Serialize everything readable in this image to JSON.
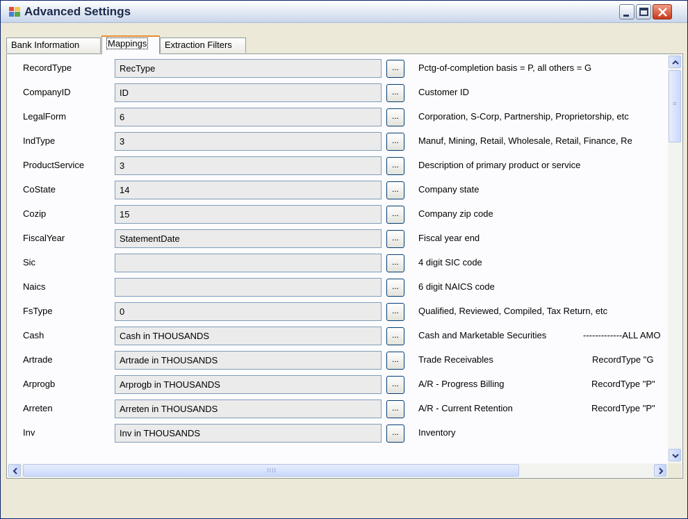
{
  "window": {
    "title": "Advanced Settings",
    "icon": "app-window-icon"
  },
  "tabs": [
    {
      "label": "Bank Information",
      "active": false
    },
    {
      "label": "Mappings",
      "active": true
    },
    {
      "label": "Extraction Filters",
      "active": false
    }
  ],
  "mappings": {
    "browse_label": "...",
    "rows": [
      {
        "name": "RecordType",
        "value": "RecType",
        "description": "Pctg-of-completion basis = P,  all others = G",
        "note": ""
      },
      {
        "name": "CompanyID",
        "value": "ID",
        "description": "Customer ID",
        "note": ""
      },
      {
        "name": "LegalForm",
        "value": "6",
        "description": "Corporation, S-Corp, Partnership, Proprietorship, etc",
        "note": ""
      },
      {
        "name": "IndType",
        "value": "3",
        "description": "Manuf, Mining, Retail, Wholesale, Retail, Finance, Re",
        "note": ""
      },
      {
        "name": "ProductService",
        "value": "3",
        "description": "Description of primary product or service",
        "note": ""
      },
      {
        "name": "CoState",
        "value": "14",
        "description": "Company state",
        "note": ""
      },
      {
        "name": "Cozip",
        "value": "15",
        "description": "Company zip code",
        "note": ""
      },
      {
        "name": "FiscalYear",
        "value": "StatementDate",
        "description": "Fiscal year end",
        "note": ""
      },
      {
        "name": "Sic",
        "value": "",
        "description": "4 digit SIC code",
        "note": ""
      },
      {
        "name": "Naics",
        "value": "",
        "description": "6 digit NAICS code",
        "note": ""
      },
      {
        "name": "FsType",
        "value": "0",
        "description": "Qualified, Reviewed, Compiled, Tax Return, etc",
        "note": ""
      },
      {
        "name": "Cash",
        "value": "Cash in THOUSANDS",
        "description": "Cash and Marketable Securities",
        "note": "-------------ALL AMO"
      },
      {
        "name": "Artrade",
        "value": "Artrade in THOUSANDS",
        "description": "Trade Receivables",
        "note": "RecordType \"G"
      },
      {
        "name": "Arprogb",
        "value": "Arprogb in THOUSANDS",
        "description": "A/R - Progress Billing",
        "note": "RecordType \"P\""
      },
      {
        "name": "Arreten",
        "value": "Arreten in THOUSANDS",
        "description": "A/R - Current Retention",
        "note": "RecordType \"P\""
      },
      {
        "name": "Inv",
        "value": "Inv in THOUSANDS",
        "description": "Inventory",
        "note": ""
      }
    ]
  },
  "scrollbars": {
    "hscroll_grip": "IIII",
    "vscroll_grip": "≡"
  },
  "colors": {
    "tab_highlight": "#e68b2c",
    "close_button": "#c8381a",
    "field_background": "#ebebeb"
  }
}
